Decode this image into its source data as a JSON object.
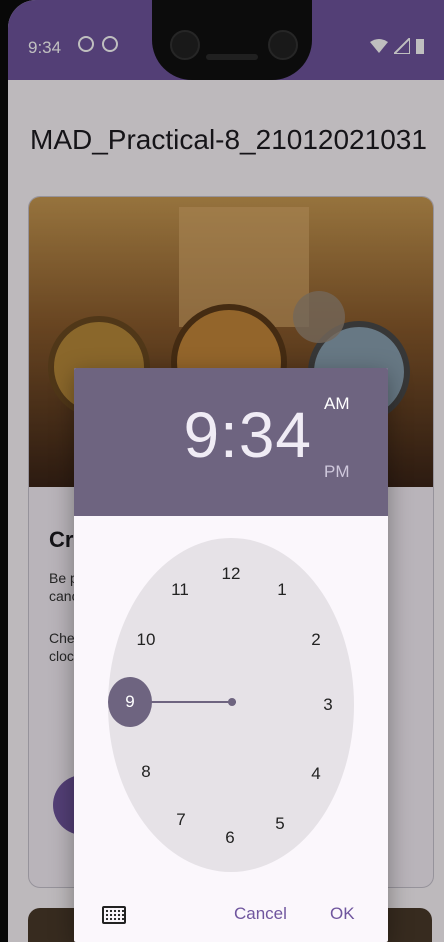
{
  "status_bar": {
    "time": "9:34"
  },
  "app": {
    "title": "MAD_Practical-8_21012021031"
  },
  "card": {
    "title_partial": "Cre",
    "text1_partial": "Be p\ncanc",
    "text2_partial": "Che\ncloc"
  },
  "time_picker": {
    "hour_minute": "9:34",
    "am_label": "AM",
    "pm_label": "PM",
    "selected_hour": "9",
    "clock_numbers": [
      "12",
      "1",
      "2",
      "3",
      "4",
      "5",
      "6",
      "7",
      "8",
      "10",
      "11"
    ],
    "cancel_label": "Cancel",
    "ok_label": "OK"
  },
  "colors": {
    "primary": "#6f559e",
    "header": "#6e6480",
    "clock_face": "#e6e2e7"
  }
}
